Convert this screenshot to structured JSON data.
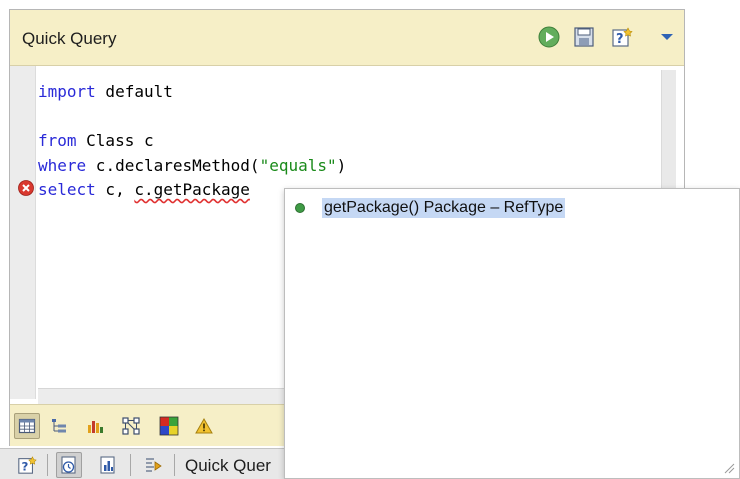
{
  "panel": {
    "title": "Quick Query",
    "header_buttons": [
      {
        "icon": "run-icon",
        "color": "#62ad5c"
      },
      {
        "icon": "save-icon"
      },
      {
        "icon": "help-icon"
      },
      {
        "icon": "view-menu-icon",
        "color": "#2f63b5"
      }
    ]
  },
  "editor": {
    "lines": [
      {
        "keyword": "import",
        "rest": " default"
      },
      {
        "keyword": "",
        "rest": ""
      },
      {
        "keyword": "from",
        "rest": " Class c"
      },
      {
        "keyword": "where",
        "rest": " c.declaresMethod(",
        "string": "\"equals\"",
        "tail": ")"
      },
      {
        "keyword": "select",
        "rest": " c, ",
        "error": "c.getPackage"
      }
    ],
    "error_marker": "error-icon"
  },
  "autocomplete": {
    "items": [
      {
        "label": "getPackage() Package – RefType",
        "icon": "method-icon",
        "selected": true
      }
    ]
  },
  "results_toolbar": [
    {
      "icon": "table-view-icon",
      "pressed": true
    },
    {
      "icon": "tree-view-icon"
    },
    {
      "icon": "bar-chart-icon"
    },
    {
      "icon": "graph-view-icon"
    },
    {
      "icon": "treemap-icon"
    },
    {
      "icon": "warning-icon"
    }
  ],
  "bottom_toolbar": {
    "label": "Quick Quer",
    "buttons": [
      {
        "icon": "help-icon"
      },
      {
        "icon": "history-icon",
        "pressed": true
      },
      {
        "icon": "report-icon"
      },
      {
        "icon": "export-icon"
      }
    ]
  }
}
